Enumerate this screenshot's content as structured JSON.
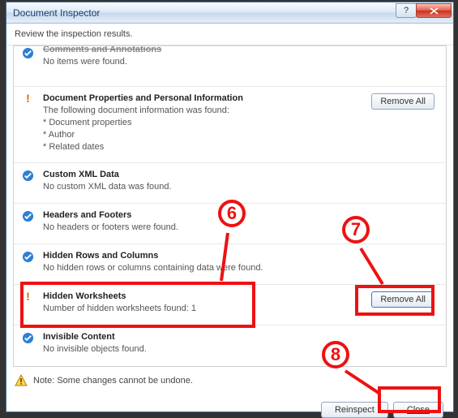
{
  "window": {
    "title": "Document Inspector",
    "subtitle": "Review the inspection results."
  },
  "sections": {
    "s0": {
      "title": "Comments and Annotations",
      "detail": "No items were found."
    },
    "s1": {
      "title": "Document Properties and Personal Information",
      "detail_line1": "The following document information was found:",
      "bullet1": "* Document properties",
      "bullet2": "* Author",
      "bullet3": "* Related dates",
      "remove": "Remove All"
    },
    "s2": {
      "title": "Custom XML Data",
      "detail": "No custom XML data was found."
    },
    "s3": {
      "title": "Headers and Footers",
      "detail": "No headers or footers were found."
    },
    "s4": {
      "title": "Hidden Rows and Columns",
      "detail": "No hidden rows or columns containing data were found."
    },
    "s5": {
      "title": "Hidden Worksheets",
      "detail": "Number of hidden worksheets found: 1",
      "remove": "Remove All"
    },
    "s6": {
      "title": "Invisible Content",
      "detail": "No invisible objects found."
    }
  },
  "footer": {
    "note": "Note: Some changes cannot be undone.",
    "reinspect": "Reinspect",
    "close": "Close"
  },
  "annotations": {
    "n6": "6",
    "n7": "7",
    "n8": "8"
  }
}
